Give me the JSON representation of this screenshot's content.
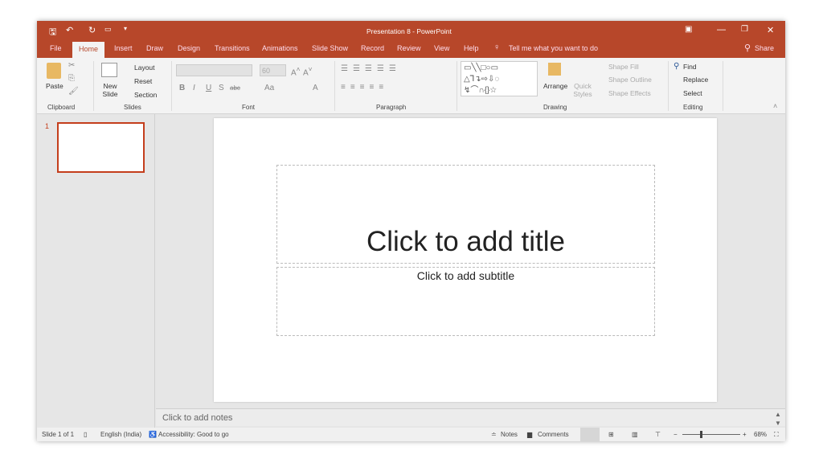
{
  "window": {
    "title": "Presentation 8  -  PowerPoint",
    "accent": "#b7472a"
  },
  "tabs": [
    "File",
    "Home",
    "Insert",
    "Draw",
    "Design",
    "Transitions",
    "Animations",
    "Slide Show",
    "Record",
    "Review",
    "View",
    "Help"
  ],
  "tell_me": "Tell me what you want to do",
  "share": "Share",
  "ribbon": {
    "clipboard": {
      "paste": "Paste",
      "label": "Clipboard"
    },
    "slides": {
      "new_slide": "New Slide",
      "layout": "Layout",
      "reset": "Reset",
      "section": "Section",
      "label": "Slides"
    },
    "font": {
      "size": "60",
      "label": "Font"
    },
    "paragraph": {
      "label": "Paragraph"
    },
    "drawing": {
      "arrange": "Arrange",
      "quick_styles": "Quick Styles",
      "shape_fill": "Shape Fill",
      "shape_outline": "Shape Outline",
      "shape_effects": "Shape Effects",
      "label": "Drawing"
    },
    "editing": {
      "find": "Find",
      "replace": "Replace",
      "select": "Select",
      "label": "Editing"
    }
  },
  "slide_panel": {
    "number": "1"
  },
  "slide": {
    "title_placeholder": "Click to add title",
    "subtitle_placeholder": "Click to add subtitle"
  },
  "notes_placeholder": "Click to add notes",
  "status": {
    "slide": "Slide 1 of 1",
    "language": "English (India)",
    "accessibility": "Accessibility: Good to go",
    "notes": "Notes",
    "comments": "Comments",
    "zoom": "68%",
    "zoom_level": 68
  }
}
